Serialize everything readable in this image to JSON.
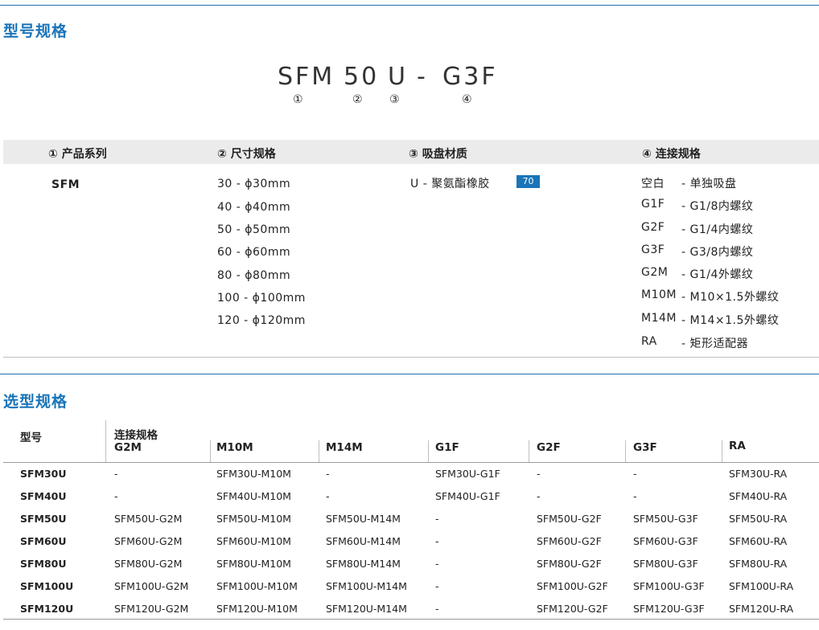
{
  "section1": {
    "title": "型号规格"
  },
  "model_code": {
    "part1": "SFM",
    "part2": "50",
    "part3": "U",
    "dash": "-",
    "part4": "G3F",
    "n1": "①",
    "n2": "②",
    "n3": "③",
    "n4": "④"
  },
  "spec": {
    "headers": [
      "① 产品系列",
      "② 尺寸规格",
      "③ 吸盘材质",
      "④ 连接规格"
    ],
    "series": [
      "SFM"
    ],
    "sizes": [
      "30  - ɸ30mm",
      "40  - ɸ40mm",
      "50  - ɸ50mm",
      "60  - ɸ60mm",
      "80  - ɸ80mm",
      "100 - ɸ100mm",
      "120 - ɸ120mm"
    ],
    "material": "U - 聚氨酯橡胶",
    "material_badge": "70",
    "connections": [
      {
        "code": "空白",
        "desc": "- 单独吸盘"
      },
      {
        "code": "G1F",
        "desc": "- G1/8内螺纹"
      },
      {
        "code": "G2F",
        "desc": "- G1/4内螺纹"
      },
      {
        "code": "G3F",
        "desc": "- G3/8内螺纹"
      },
      {
        "code": "G2M",
        "desc": "- G1/4外螺纹"
      },
      {
        "code": "M10M",
        "desc": "- M10×1.5外螺纹"
      },
      {
        "code": "M14M",
        "desc": "- M14×1.5外螺纹"
      },
      {
        "code": "RA",
        "desc": "- 矩形适配器"
      }
    ]
  },
  "section2": {
    "title": "选型规格"
  },
  "selection": {
    "model_header": "型号",
    "group_header": "连接规格",
    "columns": [
      "G2M",
      "M10M",
      "M14M",
      "G1F",
      "G2F",
      "G3F",
      "RA"
    ],
    "rows": [
      {
        "model": "SFM30U",
        "cells": [
          "-",
          "SFM30U-M10M",
          "-",
          "SFM30U-G1F",
          "-",
          "-",
          "SFM30U-RA"
        ]
      },
      {
        "model": "SFM40U",
        "cells": [
          "-",
          "SFM40U-M10M",
          "-",
          "SFM40U-G1F",
          "-",
          "-",
          "SFM40U-RA"
        ]
      },
      {
        "model": "SFM50U",
        "cells": [
          "SFM50U-G2M",
          "SFM50U-M10M",
          "SFM50U-M14M",
          "-",
          "SFM50U-G2F",
          "SFM50U-G3F",
          "SFM50U-RA"
        ]
      },
      {
        "model": "SFM60U",
        "cells": [
          "SFM60U-G2M",
          "SFM60U-M10M",
          "SFM60U-M14M",
          "-",
          "SFM60U-G2F",
          "SFM60U-G3F",
          "SFM60U-RA"
        ]
      },
      {
        "model": "SFM80U",
        "cells": [
          "SFM80U-G2M",
          "SFM80U-M10M",
          "SFM80U-M14M",
          "-",
          "SFM80U-G2F",
          "SFM80U-G3F",
          "SFM80U-RA"
        ]
      },
      {
        "model": "SFM100U",
        "cells": [
          "SFM100U-G2M",
          "SFM100U-M10M",
          "SFM100U-M14M",
          "-",
          "SFM100U-G2F",
          "SFM100U-G3F",
          "SFM100U-RA"
        ]
      },
      {
        "model": "SFM120U",
        "cells": [
          "SFM120U-G2M",
          "SFM120U-M10M",
          "SFM120U-M14M",
          "-",
          "SFM120U-G2F",
          "SFM120U-G3F",
          "SFM120U-RA"
        ]
      }
    ]
  }
}
